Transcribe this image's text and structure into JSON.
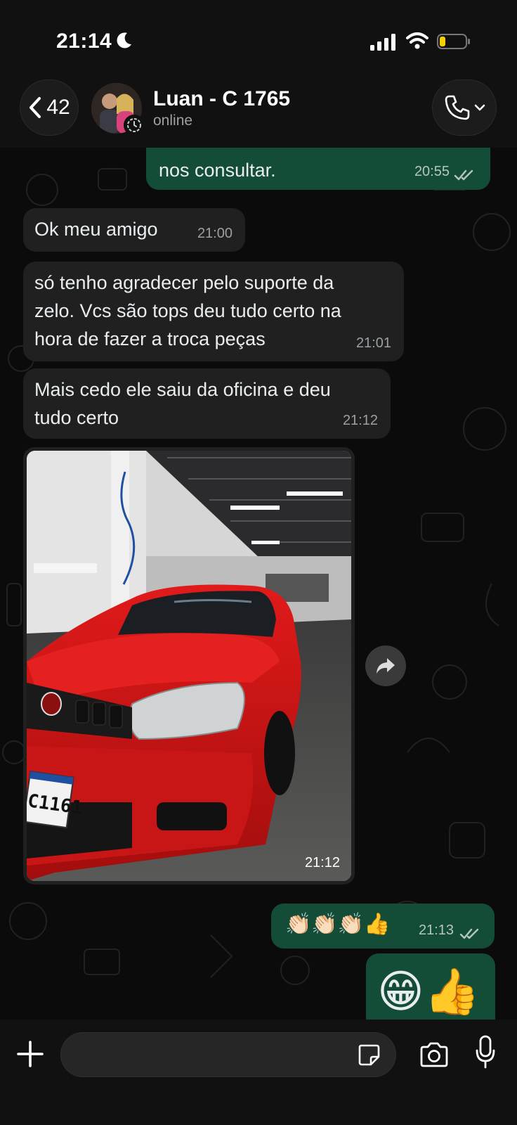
{
  "status_bar": {
    "time": "21:14"
  },
  "header": {
    "back_count": "42",
    "contact_name": "Luan - C 1765",
    "contact_status": "online"
  },
  "messages": [
    {
      "direction": "out",
      "text": "nos consultar.",
      "time": "20:55",
      "read": true
    },
    {
      "direction": "in",
      "text": "Ok meu amigo",
      "time": "21:00"
    },
    {
      "direction": "in",
      "lines": [
        "só tenho agradecer pelo suporte da",
        "zelo. Vcs são tops deu tudo certo na",
        "hora de fazer a troca peças"
      ],
      "time": "21:01"
    },
    {
      "direction": "in",
      "lines": [
        "Mais cedo ele saiu da oficina e deu",
        "tudo certo"
      ],
      "time": "21:12"
    },
    {
      "direction": "in",
      "type": "photo",
      "time": "21:12",
      "plate_text": "C1161"
    },
    {
      "direction": "out",
      "text": "👏🏻👏🏻👏🏻👍",
      "time": "21:13",
      "read": true
    },
    {
      "direction": "out",
      "text": "😁👍",
      "type": "emoji-only"
    }
  ],
  "composer": {
    "placeholder": ""
  },
  "colors": {
    "outgoing_bubble": "#144d37",
    "incoming_bubble": "#202020",
    "background": "#0b0b0b"
  },
  "icons": [
    "moon-icon",
    "signal-icon",
    "wifi-icon",
    "battery-icon",
    "back-chevron-icon",
    "phone-icon",
    "chevron-down-icon",
    "forward-icon",
    "plus-icon",
    "sticker-icon",
    "camera-icon",
    "microphone-icon",
    "double-check-icon"
  ]
}
